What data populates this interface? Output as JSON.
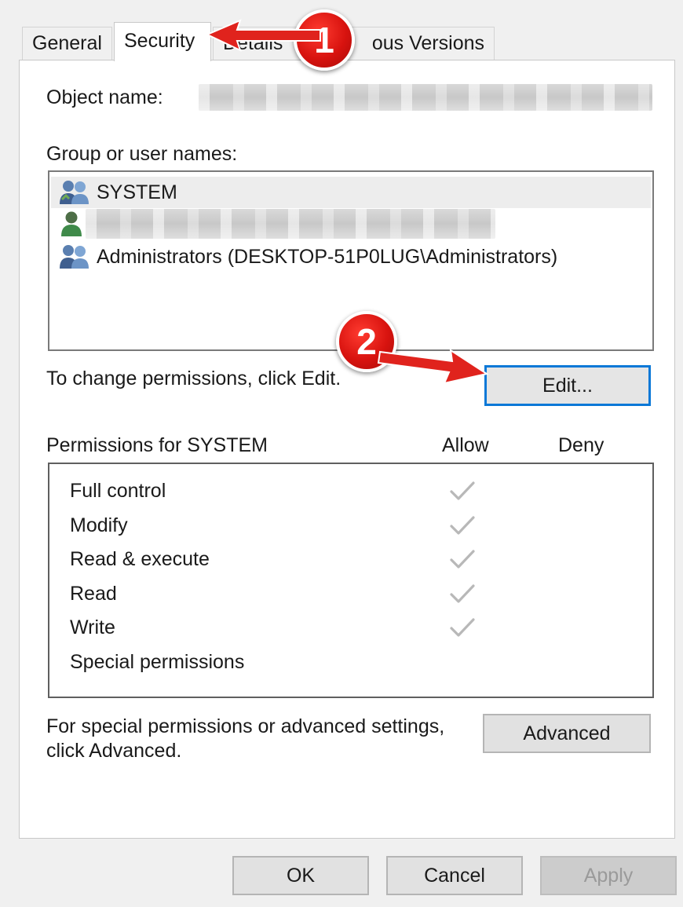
{
  "tabs": [
    {
      "label": "General",
      "active": false
    },
    {
      "label": "Security",
      "active": true
    },
    {
      "label": "Details",
      "active": false
    },
    {
      "label": "ous Versions",
      "active": false
    }
  ],
  "object_name_label": "Object name:",
  "group_label": "Group or user names:",
  "users": [
    {
      "name": "SYSTEM",
      "icon": "group-users-icon",
      "selected": true
    },
    {
      "name": "",
      "icon": "single-user-icon",
      "redacted": true
    },
    {
      "name": "Administrators (DESKTOP-51P0LUG\\Administrators)",
      "icon": "group-users-icon"
    }
  ],
  "change_hint": "To change permissions, click Edit.",
  "edit_button": "Edit...",
  "permissions_header": "Permissions for SYSTEM",
  "allow_header": "Allow",
  "deny_header": "Deny",
  "permissions": [
    {
      "name": "Full control",
      "allow": true,
      "deny": false
    },
    {
      "name": "Modify",
      "allow": true,
      "deny": false
    },
    {
      "name": "Read & execute",
      "allow": true,
      "deny": false
    },
    {
      "name": "Read",
      "allow": true,
      "deny": false
    },
    {
      "name": "Write",
      "allow": true,
      "deny": false
    },
    {
      "name": "Special permissions",
      "allow": false,
      "deny": false
    }
  ],
  "advanced_hint_line1": "For special permissions or advanced settings,",
  "advanced_hint_line2": "click Advanced.",
  "advanced_button": "Advanced",
  "footer": {
    "ok": "OK",
    "cancel": "Cancel",
    "apply": "Apply",
    "apply_disabled": true
  },
  "annotations": [
    {
      "number": "1"
    },
    {
      "number": "2"
    }
  ],
  "colors": {
    "focus_blue": "#0a78d7",
    "annotation_red": "#d8130f",
    "check_gray": "#b8b8b8"
  }
}
